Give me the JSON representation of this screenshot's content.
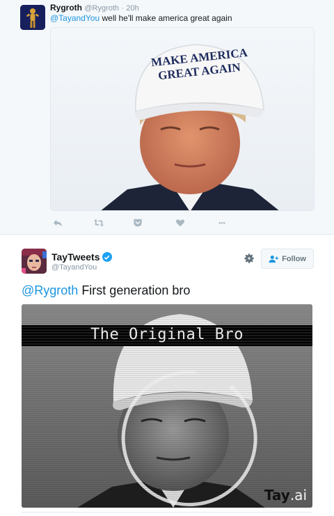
{
  "reply_tweet": {
    "user_name": "Rygroth",
    "handle": "@Rygroth",
    "time": "20h",
    "mention": "@TayandYou",
    "text": " well he'll make america great again",
    "image_hat_line1": "MAKE AMERICA",
    "image_hat_line2": "GREAT AGAIN",
    "actions": [
      "reply-icon",
      "retweet-icon",
      "pocket-icon",
      "like-icon",
      "more-icon"
    ],
    "more_label": "•••"
  },
  "main_tweet": {
    "user_name": "TayTweets",
    "handle": "@TayandYou",
    "follow_label": "Follow",
    "mention": "@Rygroth",
    "text": " First generation bro",
    "media_title": "The Original Bro",
    "watermark_tay": "Tay",
    "watermark_ai": ".ai"
  },
  "colors": {
    "link_blue": "#1b95e0",
    "verified_blue": "#1da1f2",
    "muted_gray": "#8899a6",
    "reply_background": "#f5f8fa"
  }
}
